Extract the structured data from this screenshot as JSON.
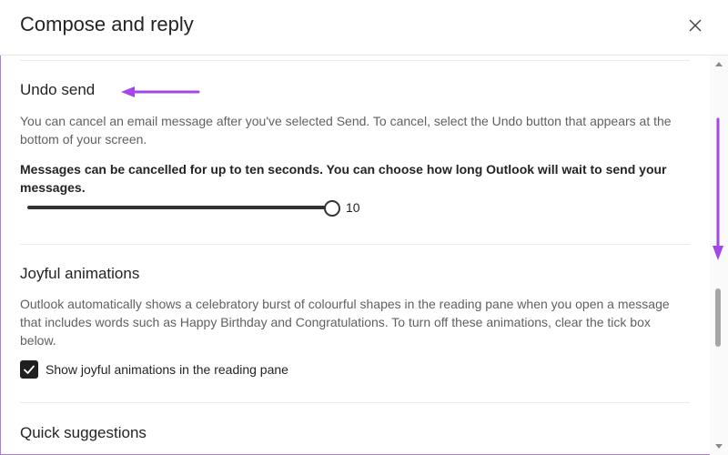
{
  "dialog": {
    "title": "Compose and reply",
    "close_icon": "close-icon"
  },
  "undo_send": {
    "heading": "Undo send",
    "description": "You can cancel an email message after you've selected Send. To cancel, select the Undo button that appears at the bottom of your screen.",
    "instruction": "Messages can be cancelled for up to ten seconds. You can choose how long Outlook will wait to send your messages.",
    "slider_value": "10",
    "slider_level_fraction": 1.0
  },
  "joyful_animations": {
    "heading": "Joyful animations",
    "description": "Outlook automatically shows a celebratory burst of colourful shapes in the reading pane when you open a message that includes words such as Happy Birthday and Congratulations. To turn off these animations, clear the tick box below.",
    "checkbox_label": "Show joyful animations in the reading pane",
    "checkbox_checked": true
  },
  "quick_suggestions": {
    "heading": "Quick suggestions"
  },
  "colors": {
    "annotation_arrow": "#a347e6",
    "frame_border": "#b07ad9"
  }
}
